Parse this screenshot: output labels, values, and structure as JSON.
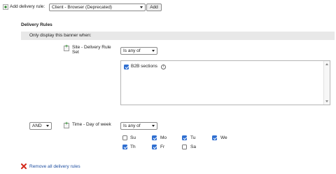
{
  "toolbar": {
    "add_label": "Add delivery rule:",
    "rule_select": "Client - Browser (Deprecated)",
    "add_button": "Add"
  },
  "section": {
    "title": "Delivery Rules",
    "subheader": "Only display this banner when:"
  },
  "rule_site": {
    "label_line1": "Site - Delivery Rule",
    "label_line2": "Set",
    "operator": "Is any of",
    "items": [
      {
        "label": "B2B sections",
        "checked": true
      }
    ]
  },
  "rule_time": {
    "connector": "AND",
    "label": "Time - Day of week",
    "operator": "Is any of",
    "days": [
      {
        "label": "Su",
        "checked": false
      },
      {
        "label": "Mo",
        "checked": true
      },
      {
        "label": "Tu",
        "checked": true
      },
      {
        "label": "We",
        "checked": true
      },
      {
        "label": "Th",
        "checked": true
      },
      {
        "label": "Fr",
        "checked": true
      },
      {
        "label": "Sa",
        "checked": false
      }
    ]
  },
  "footer": {
    "remove_all": "Remove all delivery rules"
  },
  "colors": {
    "accent": "#2f6fd1",
    "link": "#1f4fa0",
    "section_bg": "#e8e8e8",
    "remove_icon": "#d42a1c"
  }
}
